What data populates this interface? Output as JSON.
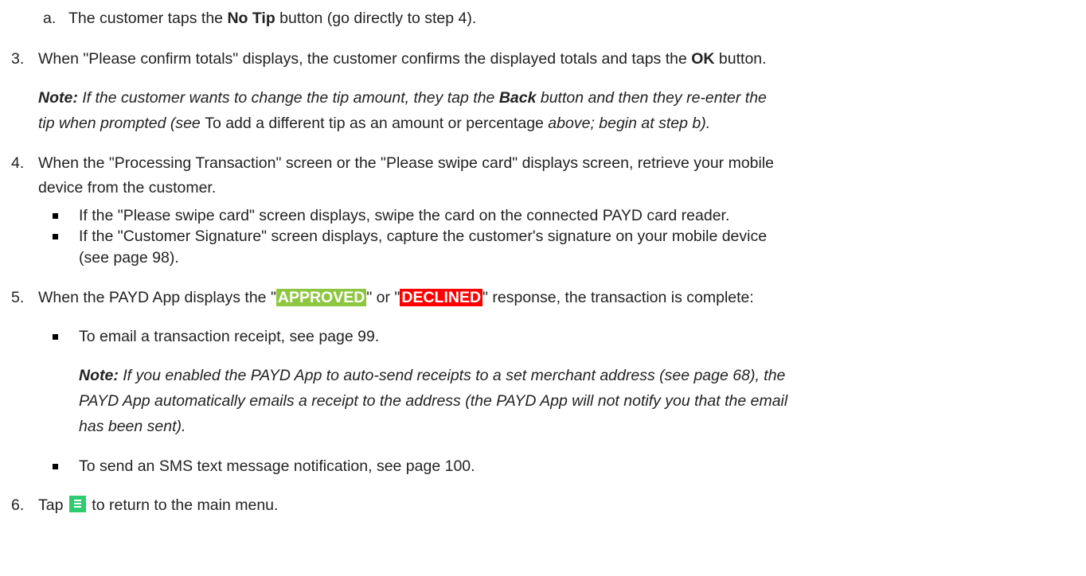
{
  "steps": {
    "s2a": {
      "marker": "a.",
      "pre": "The customer taps the ",
      "bold": "No Tip",
      "post": " button (go directly to step 4)."
    },
    "s3": {
      "marker": "3.",
      "pre": "When \"Please confirm totals\" displays, the customer confirms the displayed totals and taps the ",
      "bold": "OK",
      "post": " button."
    },
    "note1": {
      "label": "Note:",
      "l1_a": "If the customer wants to change the tip amount, they tap the ",
      "l1_b": "Back",
      "l1_c": " button and then they re-enter the",
      "l2_a": "tip when prompted (see ",
      "l2_b": "To add a different tip as an amount or percentage",
      "l2_c": " above; begin at step b)."
    },
    "s4": {
      "marker": "4.",
      "l1": "When the \"Processing Transaction\" screen or the \"Please swipe card\" displays screen, retrieve your mobile",
      "l2": "device from the customer."
    },
    "b1": "If the \"Please swipe card\" screen displays, swipe the card on the connected PAYD card reader.",
    "b2": {
      "l1": "If the \"Customer Signature\" screen displays, capture the customer's signature on your mobile device",
      "l2": "(see page 98)."
    },
    "s5": {
      "marker": "5.",
      "pre": "When the PAYD App displays the \"",
      "approved": "APPROVED",
      "mid": "\" or \"",
      "declined": "DECLINED",
      "post": "\" response, the transaction is complete:"
    },
    "b3": "To email a transaction receipt, see page 99.",
    "note2": {
      "label": "Note:",
      "l1": "If you enabled the PAYD App to auto-send receipts to a set merchant address (see page 68), the",
      "l2": "PAYD App automatically emails a receipt to the address (the PAYD App will not notify you that the email",
      "l3": "has been sent)."
    },
    "b4": "To send an SMS text message notification, see page 100.",
    "s6": {
      "marker": "6.",
      "pre": "Tap",
      "icon": "menu-icon",
      "post": "to return to the main menu."
    }
  }
}
